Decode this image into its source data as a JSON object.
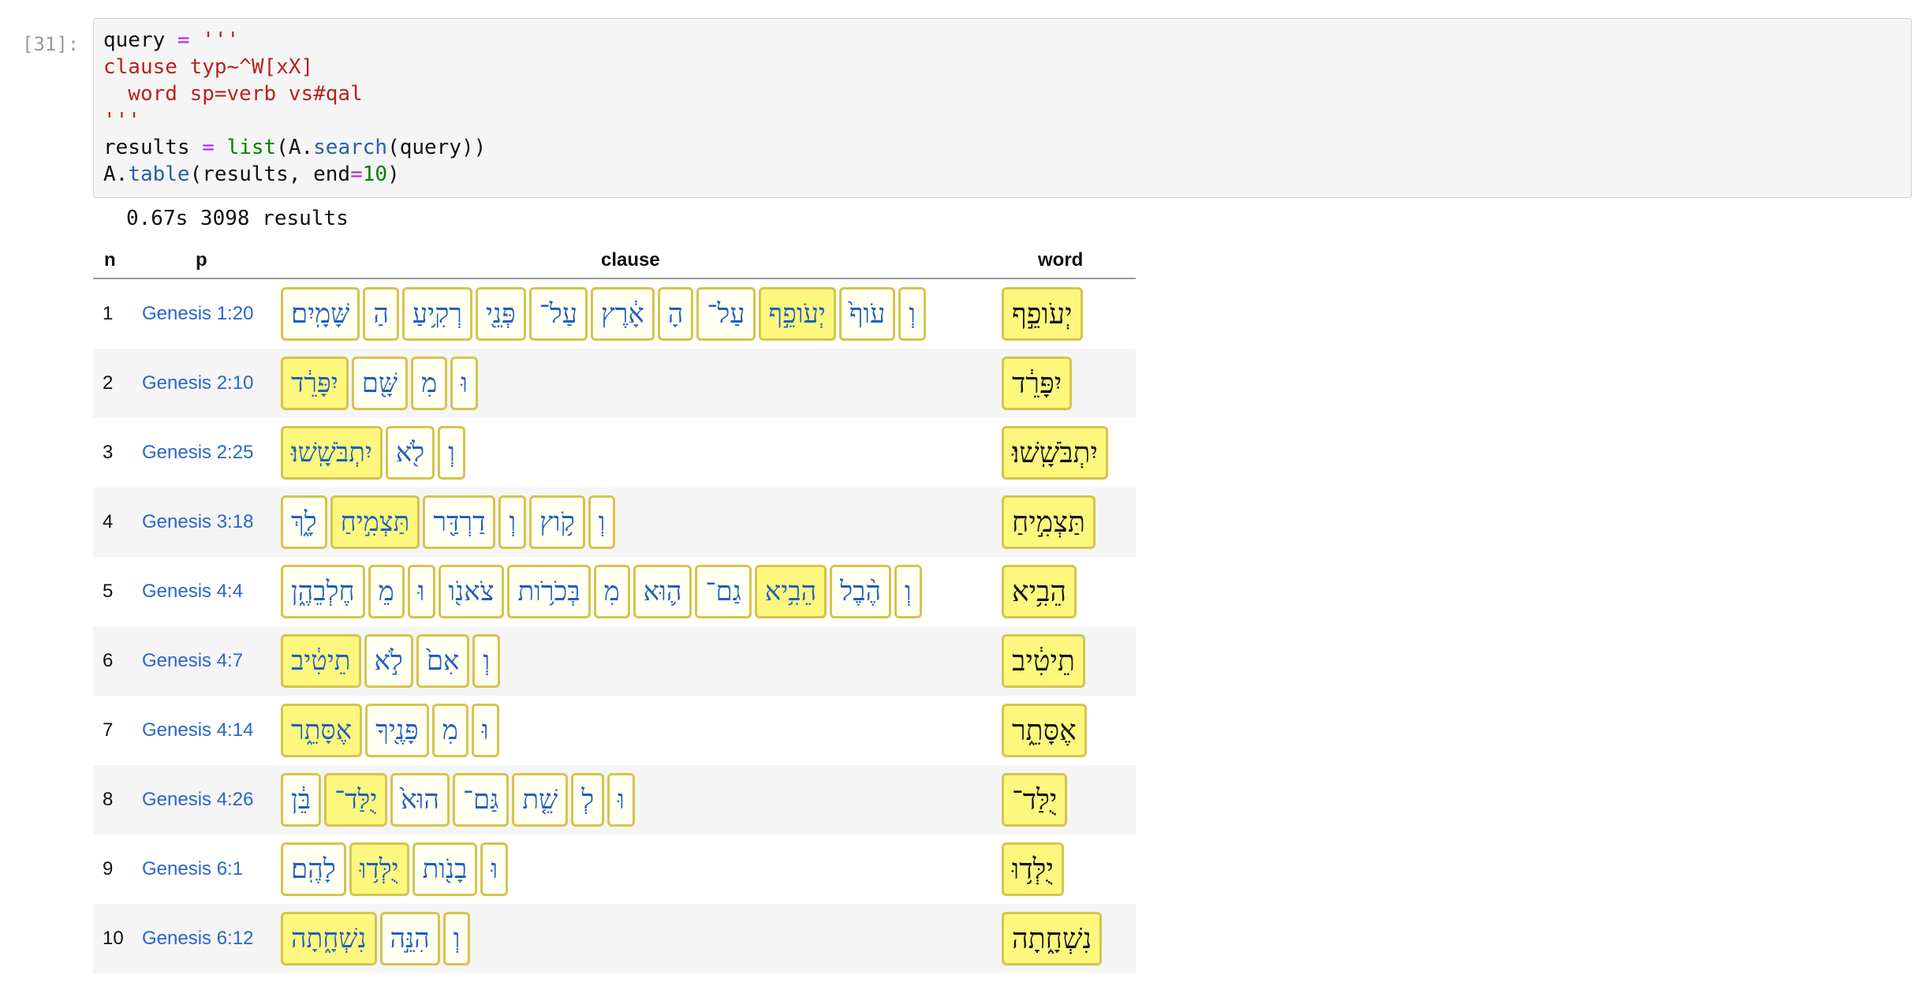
{
  "cell": {
    "prompt": "[31]:",
    "code_lines": {
      "l1_a": "query",
      "l1_b": " = ",
      "l1_c": "'''",
      "l2": "clause typ~^W[xX]",
      "l3": "  word sp=verb vs#qal",
      "l4": "'''",
      "l5_a": "results",
      "l5_b": " = ",
      "l5_c": "list",
      "l5_d": "(A.",
      "l5_e": "search",
      "l5_f": "(query))",
      "l6_a": "A.",
      "l6_b": "table",
      "l6_c": "(results, end",
      "l6_d": "=",
      "l6_e": "10",
      "l6_f": ")"
    }
  },
  "output": {
    "summary": "0.67s 3098 results",
    "headers": {
      "n": "n",
      "p": "p",
      "clause": "clause",
      "word": "word"
    },
    "rows": [
      {
        "n": "1",
        "p": "Genesis 1:20",
        "clause": [
          {
            "t": "וְ",
            "hl": false
          },
          {
            "t": "עֹוף֙",
            "hl": false
          },
          {
            "t": "יְעֹופֵ֣ף",
            "hl": true
          },
          {
            "t": "עַל־",
            "hl": false
          },
          {
            "t": "הָ",
            "hl": false
          },
          {
            "t": "אָ֔רֶץ",
            "hl": false
          },
          {
            "t": "עַל־",
            "hl": false
          },
          {
            "t": "פְּנֵ֖י",
            "hl": false
          },
          {
            "t": "רְקִ֥יעַ",
            "hl": false
          },
          {
            "t": "הַ",
            "hl": false
          },
          {
            "t": "שָּׁמָֽיִם׃",
            "hl": false
          }
        ],
        "word": "יְעֹופֵ֣ף"
      },
      {
        "n": "2",
        "p": "Genesis 2:10",
        "clause": [
          {
            "t": "וּ",
            "hl": false
          },
          {
            "t": "מִ",
            "hl": false
          },
          {
            "t": "שָּׁ֖ם",
            "hl": false
          },
          {
            "t": "יִפָּרֵ֔ד",
            "hl": true
          }
        ],
        "word": "יִפָּרֵ֔ד"
      },
      {
        "n": "3",
        "p": "Genesis 2:25",
        "clause": [
          {
            "t": "וְ",
            "hl": false
          },
          {
            "t": "לֹ֖א",
            "hl": false
          },
          {
            "t": "יִתְבֹּשָֽׁשׁוּ׃",
            "hl": true
          }
        ],
        "word": "יִתְבֹּשָֽׁשׁוּ׃"
      },
      {
        "n": "4",
        "p": "Genesis 3:18",
        "clause": [
          {
            "t": "וְ",
            "hl": false
          },
          {
            "t": "קֹ֥וץ",
            "hl": false
          },
          {
            "t": "וְ",
            "hl": false
          },
          {
            "t": "דַרְדַּ֖ר",
            "hl": false
          },
          {
            "t": "תַּצְמִ֣יחַ",
            "hl": true
          },
          {
            "t": "לָ֑ךְ",
            "hl": false
          }
        ],
        "word": "תַּצְמִ֣יחַ"
      },
      {
        "n": "5",
        "p": "Genesis 4:4",
        "clause": [
          {
            "t": "וְ",
            "hl": false
          },
          {
            "t": "הֶ֨בֶל",
            "hl": false
          },
          {
            "t": "הֵבִ֥יא",
            "hl": true
          },
          {
            "t": "גַם־",
            "hl": false
          },
          {
            "t": "ה֛וּא",
            "hl": false
          },
          {
            "t": "מִ",
            "hl": false
          },
          {
            "t": "בְּכֹרֹ֥ות",
            "hl": false
          },
          {
            "t": "צֹאנֹ֖ו",
            "hl": false
          },
          {
            "t": "וּ",
            "hl": false
          },
          {
            "t": "מֵ",
            "hl": false
          },
          {
            "t": "חֶלְבֵהֶ֑ן",
            "hl": false
          }
        ],
        "word": "הֵבִ֥יא"
      },
      {
        "n": "6",
        "p": "Genesis 4:7",
        "clause": [
          {
            "t": "וְ",
            "hl": false
          },
          {
            "t": "אִם֙",
            "hl": false
          },
          {
            "t": "לֹ֣א",
            "hl": false
          },
          {
            "t": "תֵיטִ֔יב",
            "hl": true
          }
        ],
        "word": "תֵיטִ֔יב"
      },
      {
        "n": "7",
        "p": "Genesis 4:14",
        "clause": [
          {
            "t": "וּ",
            "hl": false
          },
          {
            "t": "מִ",
            "hl": false
          },
          {
            "t": "פָּנֶ֖יךָ",
            "hl": false
          },
          {
            "t": "אֶסָּתֵ֑ר",
            "hl": true
          }
        ],
        "word": "אֶסָּתֵ֑ר"
      },
      {
        "n": "8",
        "p": "Genesis 4:26",
        "clause": [
          {
            "t": "וּ",
            "hl": false
          },
          {
            "t": "לְ",
            "hl": false
          },
          {
            "t": "שֵׁ֤ת",
            "hl": false
          },
          {
            "t": "גַּם־",
            "hl": false
          },
          {
            "t": "הוּא֙",
            "hl": false
          },
          {
            "t": "יֻלַּד־",
            "hl": true
          },
          {
            "t": "בֵּ֔ן",
            "hl": false
          }
        ],
        "word": "יֻלַּד־"
      },
      {
        "n": "9",
        "p": "Genesis 6:1",
        "clause": [
          {
            "t": "וּ",
            "hl": false
          },
          {
            "t": "בָנֹ֖ות",
            "hl": false
          },
          {
            "t": "יֻלְּד֥וּ",
            "hl": true
          },
          {
            "t": "לָהֶֽם׃",
            "hl": false
          }
        ],
        "word": "יֻלְּד֥וּ"
      },
      {
        "n": "10",
        "p": "Genesis 6:12",
        "clause": [
          {
            "t": "וְ",
            "hl": false
          },
          {
            "t": "הִנֵּ֣ה",
            "hl": false
          },
          {
            "t": "נִשְׁחָ֑תָה",
            "hl": true
          }
        ],
        "word": "נִשְׁחָ֑תָה"
      }
    ]
  }
}
